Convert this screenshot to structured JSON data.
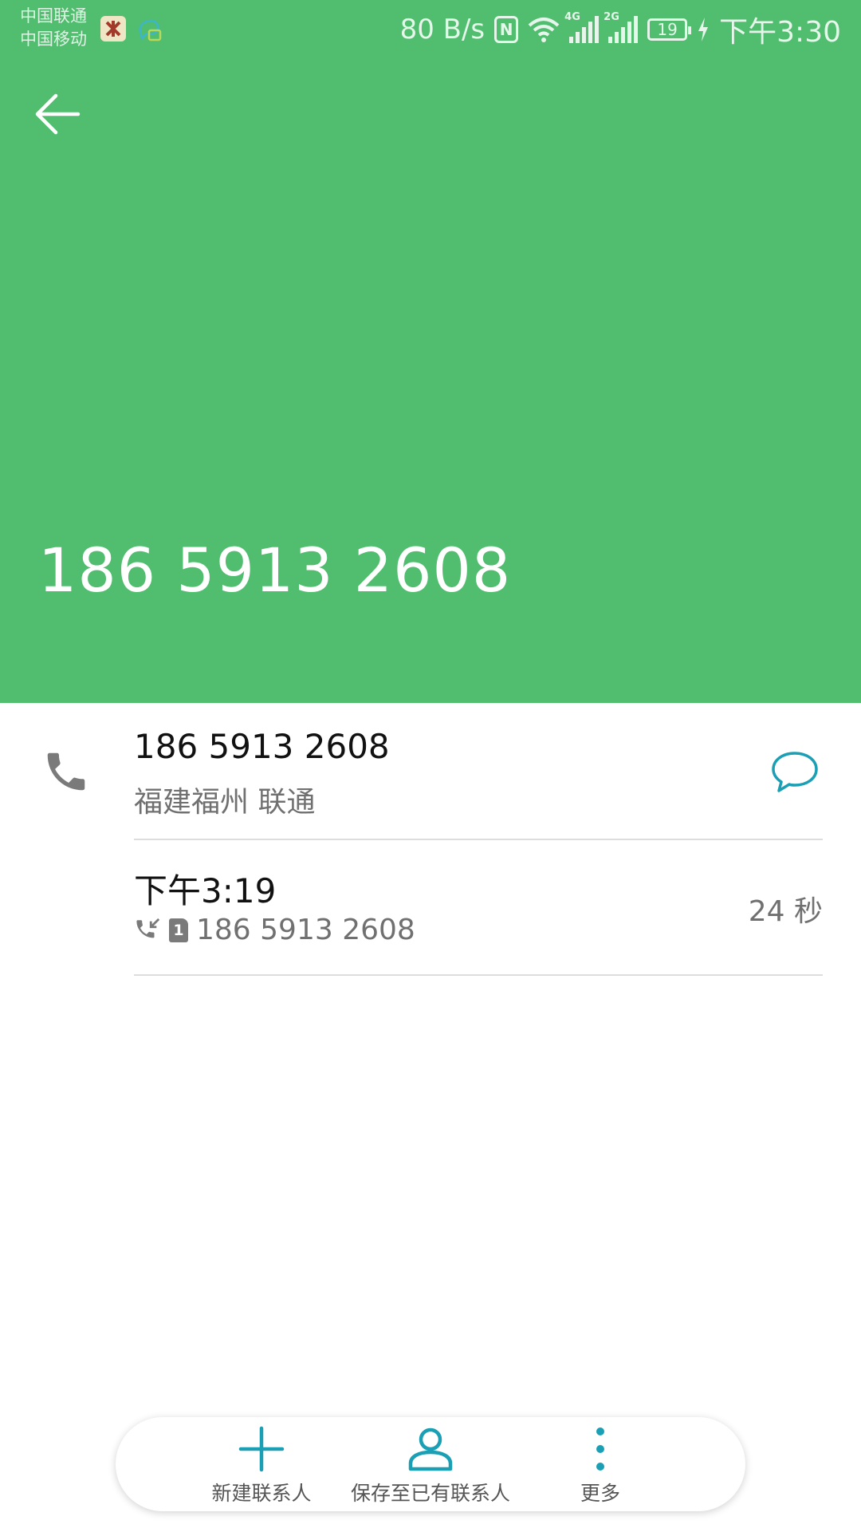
{
  "status_bar": {
    "carrier1": "中国联通",
    "carrier2": "中国移动",
    "net_speed": "80 B/s",
    "nfc": "N",
    "network1": "4G",
    "network2": "2G",
    "battery": "19",
    "time": "下午3:30"
  },
  "header": {
    "number": "186 5913 2608",
    "color": "#50bd6f"
  },
  "contact_row": {
    "number": "186 5913 2608",
    "location": "福建福州 联通"
  },
  "call_log": {
    "time": "下午3:19",
    "sim": "1",
    "number": "186 5913 2608",
    "duration": "24 秒"
  },
  "bottom_bar": {
    "new_contact": "新建联系人",
    "save_existing": "保存至已有联系人",
    "more": "更多",
    "accent": "#1a9fb5"
  }
}
